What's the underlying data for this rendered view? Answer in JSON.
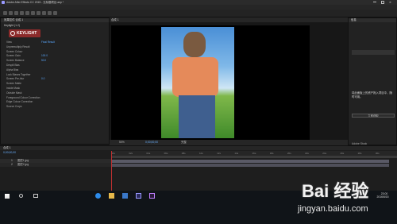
{
  "window": {
    "title": "Adobe After Effects CC 2015 - 无标题项目.aep *"
  },
  "composition": {
    "tab_label": "合成 1",
    "zoom": "50%",
    "timecode": "0;00;00;00",
    "quality": "完整"
  },
  "effects_panel": {
    "tab_label": "效果控件 合成 1",
    "effect_name": "Keylight (1.2)",
    "logo_text": "KEYLIGHT",
    "params": [
      {
        "label": "View",
        "value": "Final Result"
      },
      {
        "label": "Unpremultiply Result",
        "value": ""
      },
      {
        "label": "Screen Colour",
        "value": ""
      },
      {
        "label": "Screen Gain",
        "value": "100.0"
      },
      {
        "label": "Screen Balance",
        "value": "50.0"
      },
      {
        "label": "Despill Bias",
        "value": ""
      },
      {
        "label": "Alpha Bias",
        "value": ""
      },
      {
        "label": "Lock Biases Together",
        "value": ""
      },
      {
        "label": "Screen Pre-blur",
        "value": "0.0"
      },
      {
        "label": "Screen Matte",
        "value": ""
      },
      {
        "label": "Inside Mask",
        "value": ""
      },
      {
        "label": "Outside Mask",
        "value": ""
      },
      {
        "label": "Foreground Colour Correction",
        "value": ""
      },
      {
        "label": "Edge Colour Correction",
        "value": ""
      },
      {
        "label": "Source Crops",
        "value": ""
      }
    ]
  },
  "right_panel": {
    "tab_label": "信息",
    "tip_text": "将此面板上的资产拖入项目中，随时可用。",
    "button_label": "立即获取",
    "link_label": "Adobe Stock",
    "button2_label": "Adobe Stock 搜索"
  },
  "timeline": {
    "comp_tab": "合成 1",
    "timecode": "0;00;00;00",
    "layers": [
      {
        "index": "1",
        "name": "图层1.jpg"
      },
      {
        "index": "2",
        "name": "图层2.jpg"
      }
    ],
    "ruler_labels": [
      "00s",
      "02s",
      "04s",
      "06s",
      "08s",
      "10s",
      "12s",
      "14s",
      "16s",
      "18s",
      "20s",
      "22s",
      "24s",
      "26s",
      "28s",
      "30s"
    ]
  },
  "taskbar": {
    "time": "23:00",
    "date": "2016/6/15"
  },
  "watermark": {
    "logo": "Bai 经验",
    "url": "jingyan.baidu.com"
  },
  "colors": {
    "accent": "#2d8ceb",
    "keylight_logo": "#8c2b2b",
    "playhead": "#c03030",
    "screen_color": "#27c027"
  }
}
